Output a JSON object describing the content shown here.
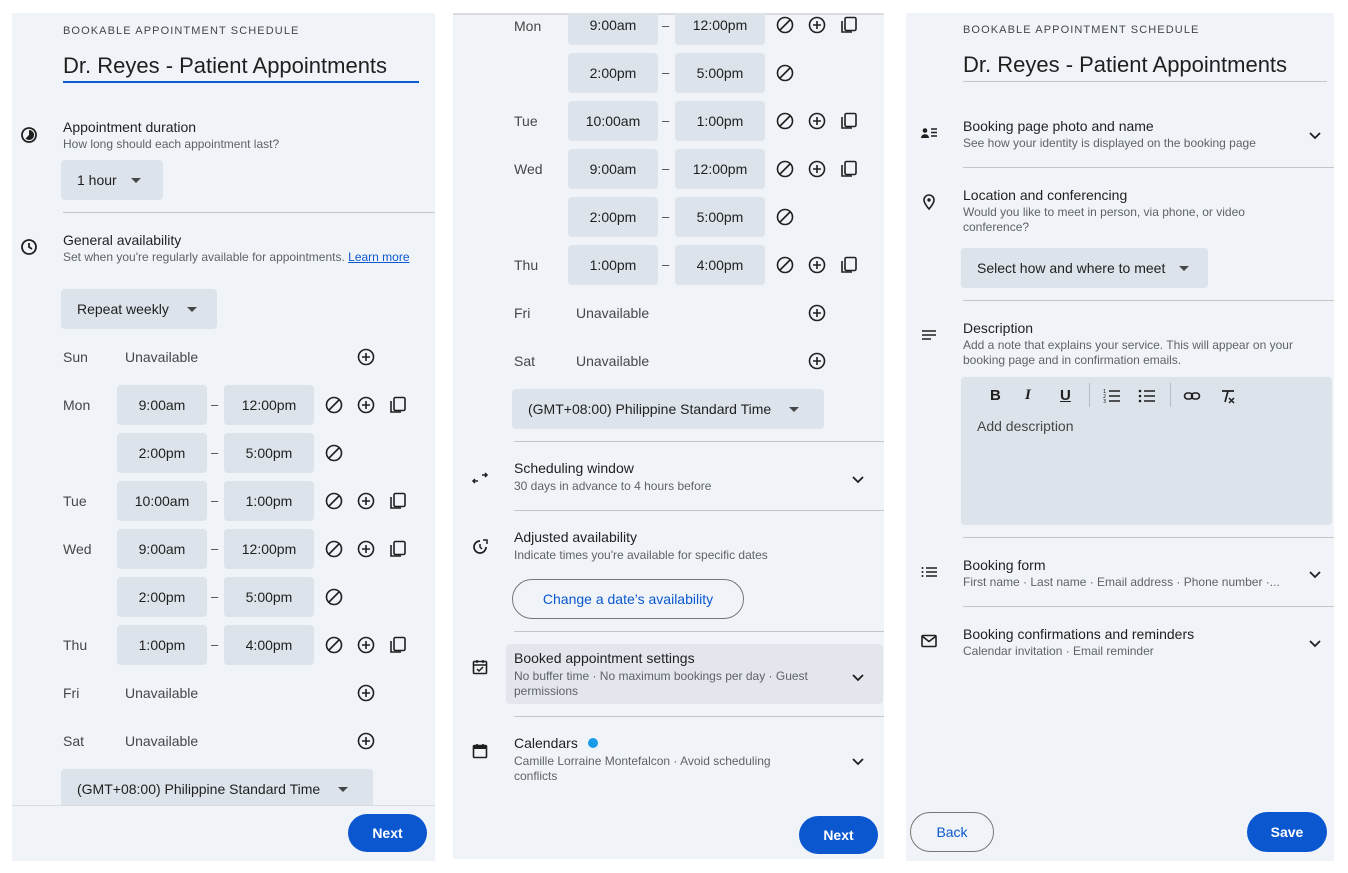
{
  "panel1": {
    "overline": "BOOKABLE APPOINTMENT SCHEDULE",
    "title": "Dr. Reyes - Patient Appointments",
    "duration": {
      "title": "Appointment duration",
      "subtitle": "How long should each appointment last?",
      "value": "1 hour"
    },
    "availability": {
      "title": "General availability",
      "subtitle": "Set when you're regularly available for appointments.",
      "learn": "Learn more",
      "repeat": "Repeat weekly"
    },
    "timezone": "(GMT+08:00) Philippine Standard Time",
    "next": "Next"
  },
  "days": {
    "sun": "Sun",
    "mon": "Mon",
    "tue": "Tue",
    "wed": "Wed",
    "thu": "Thu",
    "fri": "Fri",
    "sat": "Sat",
    "unavailable": "Unavailable",
    "dash": "–"
  },
  "times": {
    "t0900": "9:00am",
    "t1200": "12:00pm",
    "t1400": "2:00pm",
    "t1700": "5:00pm",
    "t1000": "10:00am",
    "t1300": "1:00pm",
    "t1600": "4:00pm"
  },
  "panel2": {
    "timezone": "(GMT+08:00) Philippine Standard Time",
    "scheduling": {
      "title": "Scheduling window",
      "subtitle": "30 days in advance to 4 hours before"
    },
    "adjusted": {
      "title": "Adjusted availability",
      "subtitle": "Indicate times you're available for specific dates",
      "button": "Change a date’s availability"
    },
    "booked": {
      "title": "Booked appointment settings",
      "subtitle": "No buffer time · No maximum bookings per day · Guest permissions"
    },
    "calendars": {
      "title": "Calendars",
      "subtitle": "Camille Lorraine Montefalcon · Avoid scheduling conflicts"
    },
    "next": "Next"
  },
  "panel3": {
    "overline": "BOOKABLE APPOINTMENT SCHEDULE",
    "title": "Dr. Reyes - Patient Appointments",
    "photo": {
      "title": "Booking page photo and name",
      "subtitle": "See how your identity is displayed on the booking page"
    },
    "location": {
      "title": "Location and conferencing",
      "subtitle": "Would you like to meet in person, via phone, or video conference?",
      "select": "Select how and where to meet"
    },
    "description": {
      "title": "Description",
      "subtitle": "Add a note that explains your service. This will appear on your booking page and in confirmation emails.",
      "placeholder": "Add description",
      "bold": "B",
      "italic": "I",
      "underline": "U"
    },
    "form": {
      "title": "Booking form",
      "subtitle": "First name · Last name · Email address · Phone number ·..."
    },
    "confirm": {
      "title": "Booking confirmations and reminders",
      "subtitle": "Calendar invitation · Email reminder"
    },
    "back": "Back",
    "save": "Save"
  },
  "colors": {
    "accent": "#0b57d0",
    "panel": "#f0f4f9",
    "chip": "#dde3ea",
    "dot": "#1a9be8"
  }
}
